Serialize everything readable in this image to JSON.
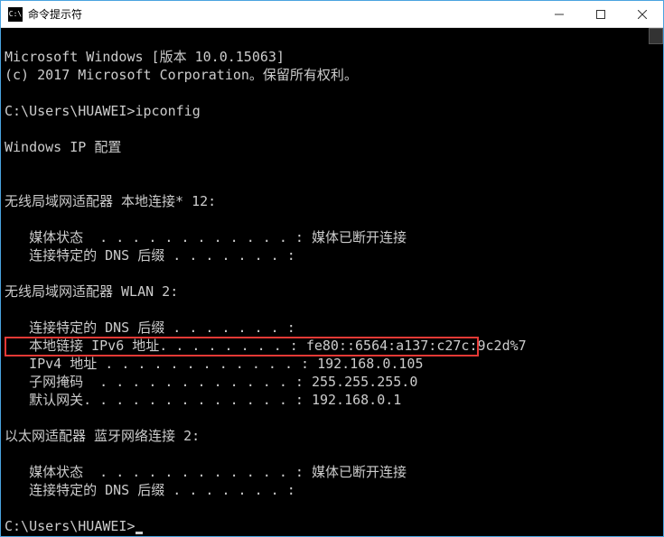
{
  "titlebar": {
    "icon_text": "C:\\",
    "title": "命令提示符"
  },
  "console": {
    "header1": "Microsoft Windows [版本 10.0.15063]",
    "header2": "(c) 2017 Microsoft Corporation。保留所有权利。",
    "prompt_path": "C:\\Users\\HUAWEI>",
    "command": "ipconfig",
    "ipconfig_title": "Windows IP 配置",
    "adapters": [
      {
        "name_line": "无线局域网适配器 本地连接* 12:",
        "lines": [
          "   媒体状态  . . . . . . . . . . . . : 媒体已断开连接",
          "   连接特定的 DNS 后缀 . . . . . . . :"
        ]
      },
      {
        "name_line": "无线局域网适配器 WLAN 2:",
        "lines": [
          "   连接特定的 DNS 后缀 . . . . . . . :",
          "   本地链接 IPv6 地址. . . . . . . . : fe80::6564:a137:c27c:9c2d%7",
          "   IPv4 地址 . . . . . . . . . . . . : 192.168.0.105",
          "   子网掩码  . . . . . . . . . . . . : 255.255.255.0",
          "   默认网关. . . . . . . . . . . . . : 192.168.0.1"
        ]
      },
      {
        "name_line": "以太网适配器 蓝牙网络连接 2:",
        "lines": [
          "   媒体状态  . . . . . . . . . . . . : 媒体已断开连接",
          "   连接特定的 DNS 后缀 . . . . . . . :"
        ]
      }
    ]
  },
  "highlight": {
    "field": "IPv4 地址",
    "value": "192.168.0.105"
  }
}
